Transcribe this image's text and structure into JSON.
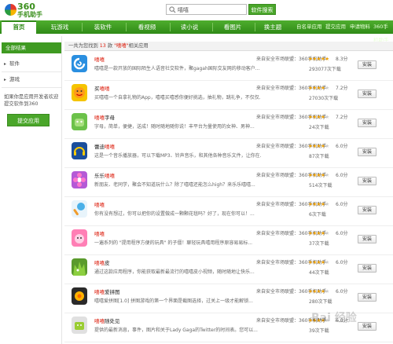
{
  "brand": {
    "logo_num": "360",
    "logo_text": "手机助手"
  },
  "search": {
    "value": "嘻嘻",
    "button": "软件搜索"
  },
  "nav": {
    "tabs": [
      "首页",
      "玩游戏",
      "装软件",
      "看视频",
      "读小说",
      "看图片",
      "换主题"
    ],
    "links": [
      "自名单应用",
      "提交应用",
      "申请物料",
      "360手机助手"
    ]
  },
  "sidebar": {
    "header": "全部结果",
    "items": [
      "软件",
      "游戏"
    ],
    "note": "如果你是应用开发者欢迎提交软件到360",
    "submit": "提交应用"
  },
  "results": {
    "prefix": "一共为您找到",
    "count": "13",
    "unit": "款",
    "keyword": "\"嘻嘻\"",
    "suffix": "相关应用"
  },
  "apps": [
    {
      "name_pre": "",
      "name_hl": "嘻嘻",
      "name_post": "",
      "desc": "嘻嘻是一款开放的国际陌生人语音社交软件，聚gagah国际交友网的移动客户...",
      "source": "来自安全市场联盟：360手机助手",
      "stars": 5,
      "score": "8.3分",
      "downloads": "293077次下载",
      "install": "安装"
    },
    {
      "name_pre": "买",
      "name_hl": "嘻嘻",
      "name_post": "",
      "desc": "买嘻嘻一个自拿礼物的App，嘻嘻买嘻感你便好挑选，抽礼物，跳礼争，不仅仅...",
      "source": "来自安全市场联盟：360手机助手",
      "stars": 4,
      "score": "7.2分",
      "downloads": "27030次下载",
      "install": "安装"
    },
    {
      "name_pre": "",
      "name_hl": "嘻嘻",
      "name_post": "字母",
      "desc": "字母，简单，便捷，送成！随时随地随你说！丰平台为量使用的女神、男神...",
      "source": "来自安全市场联盟：360手机助手",
      "stars": 4,
      "score": "7.2分",
      "downloads": "24次下载",
      "install": "安装"
    },
    {
      "name_pre": "蕾迪",
      "name_hl": "嘻嘻",
      "name_post": "",
      "desc": "这是一个音乐播放器，可以下载MP3、铃声音乐，和其他各种音乐文件，让你在...",
      "source": "来自安全市场联盟：360手机助手",
      "stars": 4,
      "score": "6.0分",
      "downloads": "87次下载",
      "install": "安装"
    },
    {
      "name_pre": "乐乐",
      "name_hl": "嘻嘻",
      "name_post": "",
      "desc": "新朋友、老同学，聚会不知道玩什么？除了嘻嘻还能怎么high？来乐乐嘻嘻...",
      "source": "来自安全市场联盟：360手机助手",
      "stars": 4,
      "score": "6.0分",
      "downloads": "514次下载",
      "install": "安装"
    },
    {
      "name_pre": "",
      "name_hl": "嘻嘻",
      "name_post": "",
      "desc": "你有没有想过，你可以把你的设置做成一颗颗花毯吗？好了，现在你可以！...",
      "source": "来自安全市场联盟：360手机助手",
      "stars": 4,
      "score": "6.0分",
      "downloads": "6次下载",
      "install": "安装"
    },
    {
      "name_pre": "",
      "name_hl": "嘻嘻",
      "name_post": "",
      "desc": "一遍系列的 \"提用程序方便的玩具\" 的子僵！聊轻玩具嘻用程序原容易易标...",
      "source": "来自安全市场联盟：360手机助手",
      "stars": 4,
      "score": "6.0分",
      "downloads": "37次下载",
      "install": "安装"
    },
    {
      "name_pre": "",
      "name_hl": "嘻嘻",
      "name_post": "皮",
      "desc": "通过这款应用程序，你能获取最新最流行的嘻嘻皮小视频，随时随地让快乐...",
      "source": "来自安全市场联盟：360手机助手",
      "stars": 4,
      "score": "6.0分",
      "downloads": "44次下载",
      "install": "安装"
    },
    {
      "name_pre": "",
      "name_hl": "嘻嘻",
      "name_post": "爱拼图",
      "desc": "嘻嘻爱拼图[1.0] 拼图游戏的第一个界面是截图选择，过关上一级才能解锁...",
      "source": "来自安全市场联盟：360手机助手",
      "stars": 4,
      "score": "6.0分",
      "downloads": "280次下载",
      "install": "安装"
    },
    {
      "name_pre": "",
      "name_hl": "嘻嘻",
      "name_post": "随处见",
      "desc": "提供的最新消息，事件，图片和关于Lady Gaga的Twitter的时间表。您可以...",
      "source": "来自安全市场联盟：360手机助手",
      "stars": 4,
      "score": "6.0分",
      "downloads": "39次下载",
      "install": "安装"
    }
  ],
  "watermark": "Bai 经验",
  "colors": {
    "brand_green": "#3f9a22",
    "highlight_red": "#d21",
    "star_gold": "#f0a000"
  },
  "icons": [
    "swirl-chat-icon",
    "smile-face-icon",
    "green-robot-icon",
    "headphones-icon",
    "flower-icon",
    "rattle-icon",
    "pink-cat-icon",
    "grass-monster-icon",
    "puzzle-flower-icon",
    "android-box-icon"
  ]
}
